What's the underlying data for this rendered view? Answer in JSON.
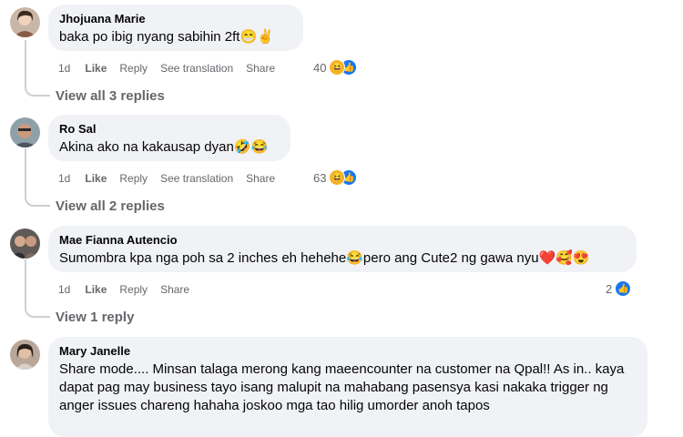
{
  "comments": [
    {
      "name": "Jhojuana Marie",
      "text": "baka po ibig nyang sabihin 2ft😁✌",
      "time": "1d",
      "like": "Like",
      "reply": "Reply",
      "translate": "See translation",
      "share": "Share",
      "reactions": "40",
      "replies": "View all 3 replies"
    },
    {
      "name": "Ro Sal",
      "text": "Akina ako na kakausap dyan🤣😂",
      "time": "1d",
      "like": "Like",
      "reply": "Reply",
      "translate": "See translation",
      "share": "Share",
      "reactions": "63",
      "replies": "View all 2 replies"
    },
    {
      "name": "Mae Fianna Autencio",
      "text": "Sumombra kpa nga poh sa 2 inches eh hehehe😂pero ang Cute2 ng gawa nyu❤️🥰😍",
      "time": "1d",
      "like": "Like",
      "reply": "Reply",
      "share": "Share",
      "reactions": "2",
      "replies": "View 1 reply"
    },
    {
      "name": "Mary Janelle",
      "text": "Share mode.... Minsan talaga merong kang maeencounter na customer na Qpal!! As in.. kaya dapat pag may business tayo isang malupit na mahabang pasensya kasi nakaka trigger ng anger issues chareng hahaha joskoo mga tao hilig umorder anoh tapos"
    }
  ],
  "icons": {
    "haha": "haha-reaction-icon",
    "like": "like-reaction-icon"
  },
  "colors": {
    "bubble": "#f0f2f5",
    "meta": "#65676b",
    "like_blue": "#1877f2",
    "haha_yellow": "#f7b125"
  }
}
